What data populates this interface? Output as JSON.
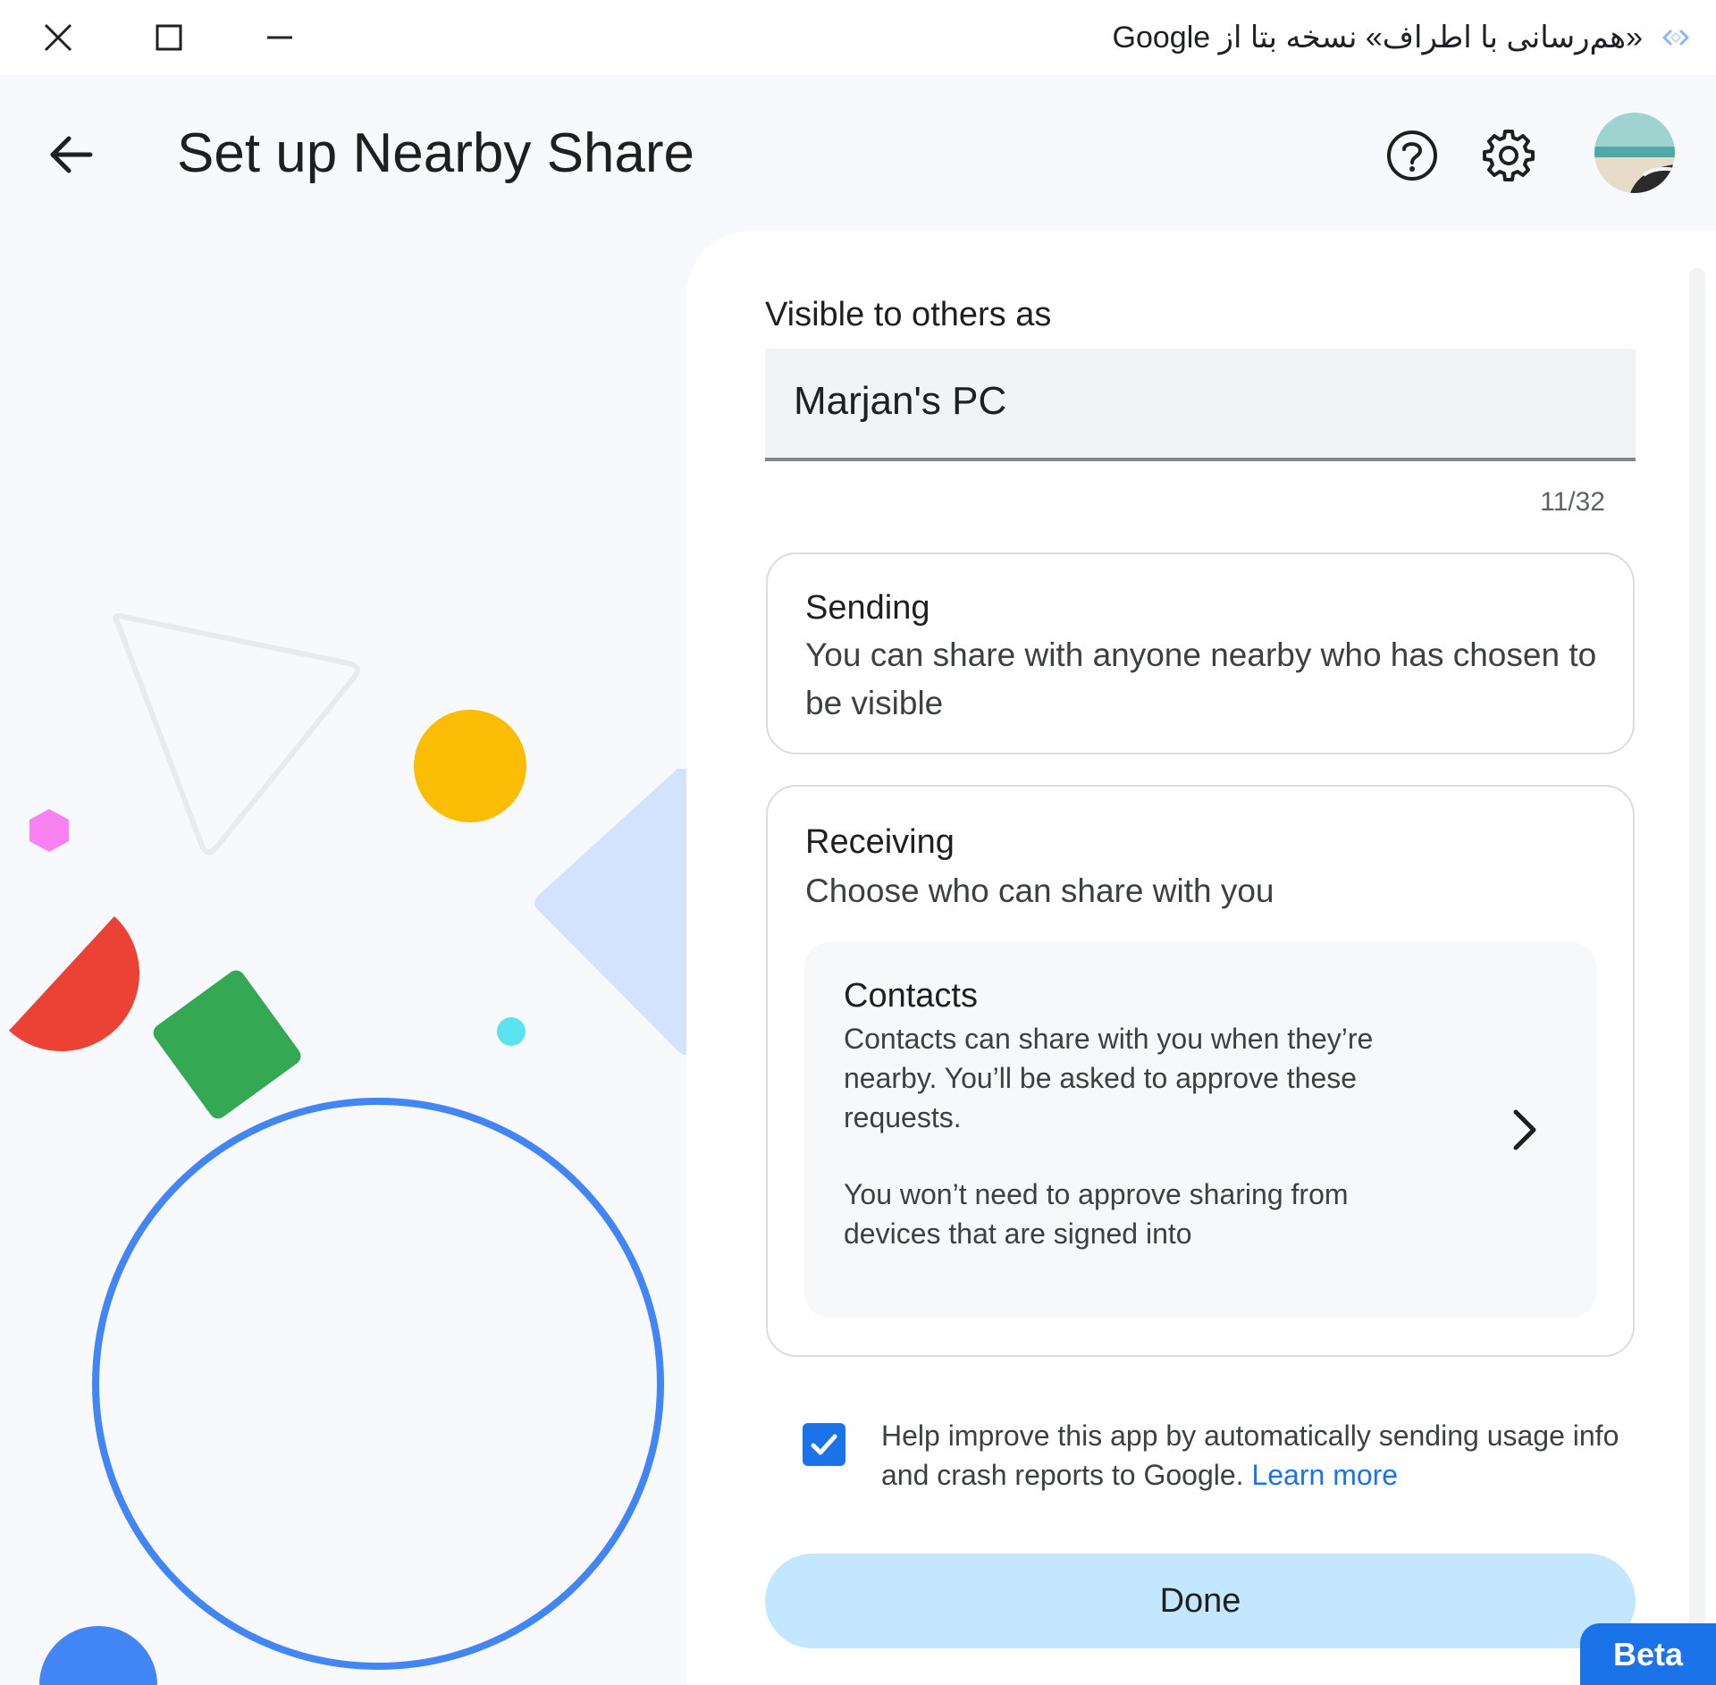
{
  "window": {
    "title": "«هم‌رسانی با اطراف» نسخه بتا از Google",
    "controls": {
      "close": "close-icon",
      "maximize": "maximize-icon",
      "minimize": "minimize-icon"
    }
  },
  "header": {
    "title": "Set up Nearby Share",
    "icons": [
      "back-arrow-icon",
      "help-icon",
      "gear-icon",
      "avatar"
    ]
  },
  "form": {
    "visible_label": "Visible to others as",
    "device_name": "Marjan's PC",
    "char_count": "11/32"
  },
  "sending": {
    "title": "Sending",
    "description": "You can share with anyone nearby who has chosen to be visible"
  },
  "receiving": {
    "title": "Receiving",
    "description": "Choose who can share with you",
    "option": {
      "title": "Contacts",
      "description": "Contacts can share with you when they’re nearby. You’ll be asked to approve these requests.",
      "description2": "You won’t need to approve sharing from devices that are signed into"
    }
  },
  "consent": {
    "checked": true,
    "text": "Help improve this app by automatically sending usage info and crash reports to Google.",
    "link": "Learn more"
  },
  "actions": {
    "done_label": "Done"
  },
  "badge": {
    "label": "Beta"
  },
  "colors": {
    "accent": "#1a73e8",
    "done_button": "#c2e7ff",
    "background": "#f7f9fc",
    "shape_yellow": "#fbbc04",
    "shape_green": "#34a853",
    "shape_red": "#ea4335",
    "shape_pink": "#f882f2",
    "shape_cyan": "#5ce3f0",
    "shape_light_blue": "#d3e3fd",
    "ring_blue": "#4285f4"
  }
}
